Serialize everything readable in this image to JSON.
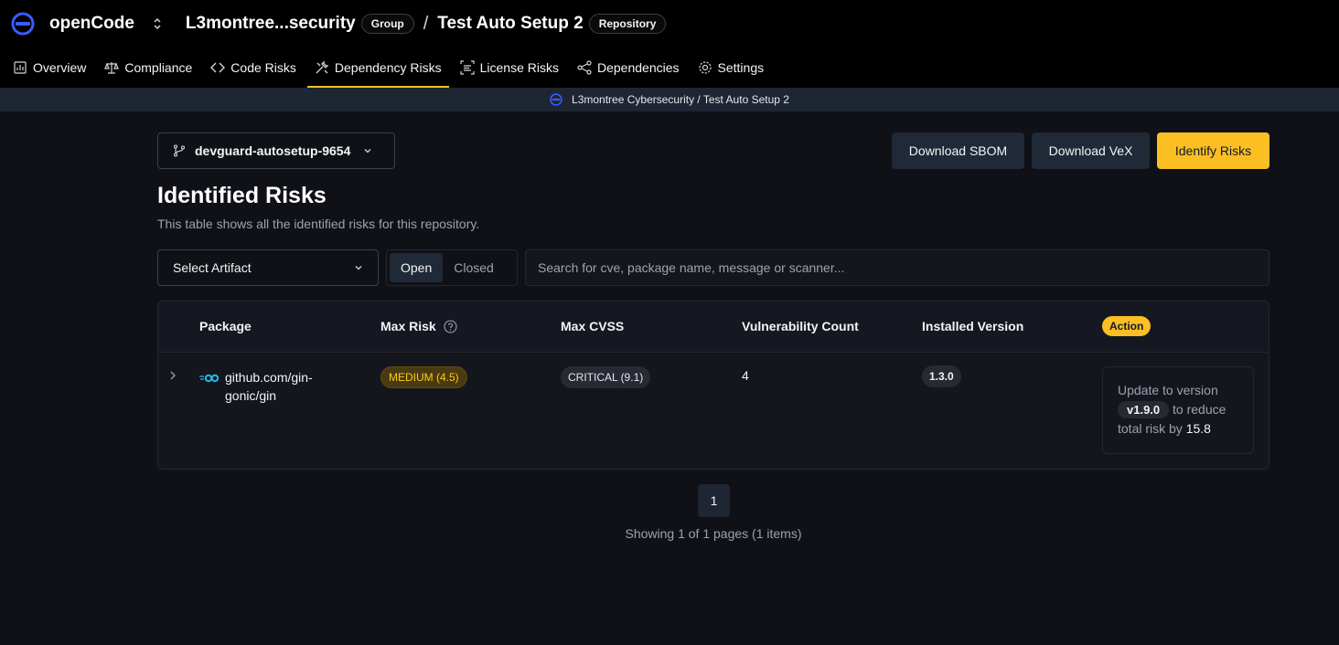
{
  "header": {
    "brand": "openCode",
    "org": "L3montree...security",
    "org_badge": "Group",
    "separator": "/",
    "repo": "Test Auto Setup 2",
    "repo_badge": "Repository"
  },
  "tabs": [
    {
      "label": "Overview",
      "icon": "chart-icon"
    },
    {
      "label": "Compliance",
      "icon": "scale-icon"
    },
    {
      "label": "Code Risks",
      "icon": "code-icon"
    },
    {
      "label": "Dependency Risks",
      "icon": "tools-icon",
      "active": true
    },
    {
      "label": "License Risks",
      "icon": "text-scan-icon"
    },
    {
      "label": "Dependencies",
      "icon": "share-icon"
    },
    {
      "label": "Settings",
      "icon": "gear-icon"
    }
  ],
  "breadcrumb": {
    "text": "L3montree Cybersecurity / Test Auto Setup 2"
  },
  "branch": {
    "label": "devguard-autosetup-9654"
  },
  "actions": {
    "download_sbom": "Download SBOM",
    "download_vex": "Download VeX",
    "identify_risks": "Identify Risks"
  },
  "page": {
    "title": "Identified Risks",
    "subtitle": "This table shows all the identified risks for this repository."
  },
  "filters": {
    "artifact_placeholder": "Select Artifact",
    "state_open": "Open",
    "state_closed": "Closed",
    "search_placeholder": "Search for cve, package name, message or scanner..."
  },
  "table": {
    "columns": {
      "package": "Package",
      "max_risk": "Max Risk",
      "max_cvss": "Max CVSS",
      "vuln_count": "Vulnerability Count",
      "installed_version": "Installed Version",
      "action": "Action"
    },
    "rows": [
      {
        "package": "github.com/gin-gonic/gin",
        "max_risk": "MEDIUM (4.5)",
        "max_cvss": "CRITICAL (9.1)",
        "vuln_count": "4",
        "installed_version": "1.3.0",
        "action_prefix": "Update to version",
        "action_version": "v1.9.0",
        "action_mid": "to reduce total risk by",
        "action_value": "15.8"
      }
    ]
  },
  "pagination": {
    "current_page": "1",
    "summary": "Showing 1 of 1 pages (1 items)"
  },
  "colors": {
    "accent": "#fbbf24",
    "brand_blue": "#3b5bfd",
    "background": "#0f1117"
  }
}
